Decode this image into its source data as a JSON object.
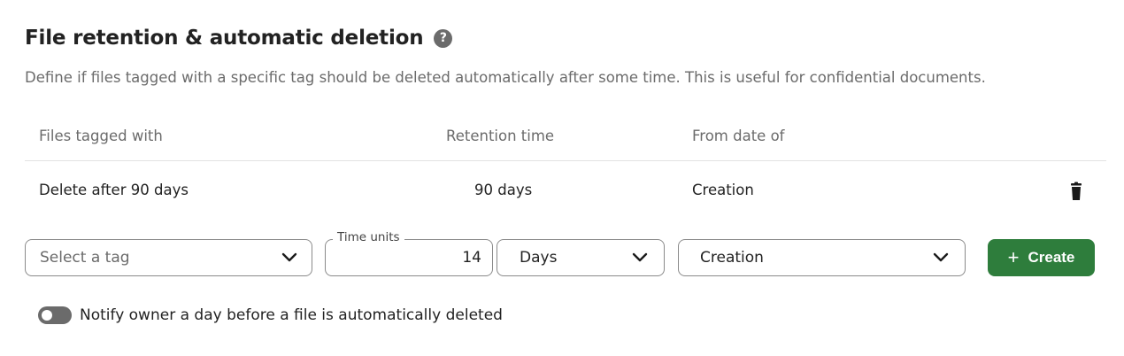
{
  "section": {
    "title": "File retention & automatic deletion",
    "help_icon": "question-circle-icon",
    "description": "Define if files tagged with a specific tag should be deleted automatically after some time. This is useful for confidential documents."
  },
  "table": {
    "headers": {
      "tag": "Files tagged with",
      "retention": "Retention time",
      "from_date": "From date of"
    },
    "rows": [
      {
        "tag": "Delete after 90 days",
        "retention": "90 days",
        "from_date": "Creation",
        "action_icon": "trash-icon"
      }
    ]
  },
  "form": {
    "tag_select": {
      "placeholder": "Select a tag",
      "value": ""
    },
    "time_units": {
      "label": "Time units",
      "value": "14"
    },
    "unit_select": {
      "value": "Days"
    },
    "from_select": {
      "value": "Creation"
    },
    "create_button": {
      "label": "Create",
      "icon": "plus-icon"
    }
  },
  "notify": {
    "label": "Notify owner a day before a file is automatically deleted",
    "enabled": false
  },
  "colors": {
    "accent": "#2e7d3c",
    "muted_text": "#6b6b6b",
    "text": "#222222"
  }
}
